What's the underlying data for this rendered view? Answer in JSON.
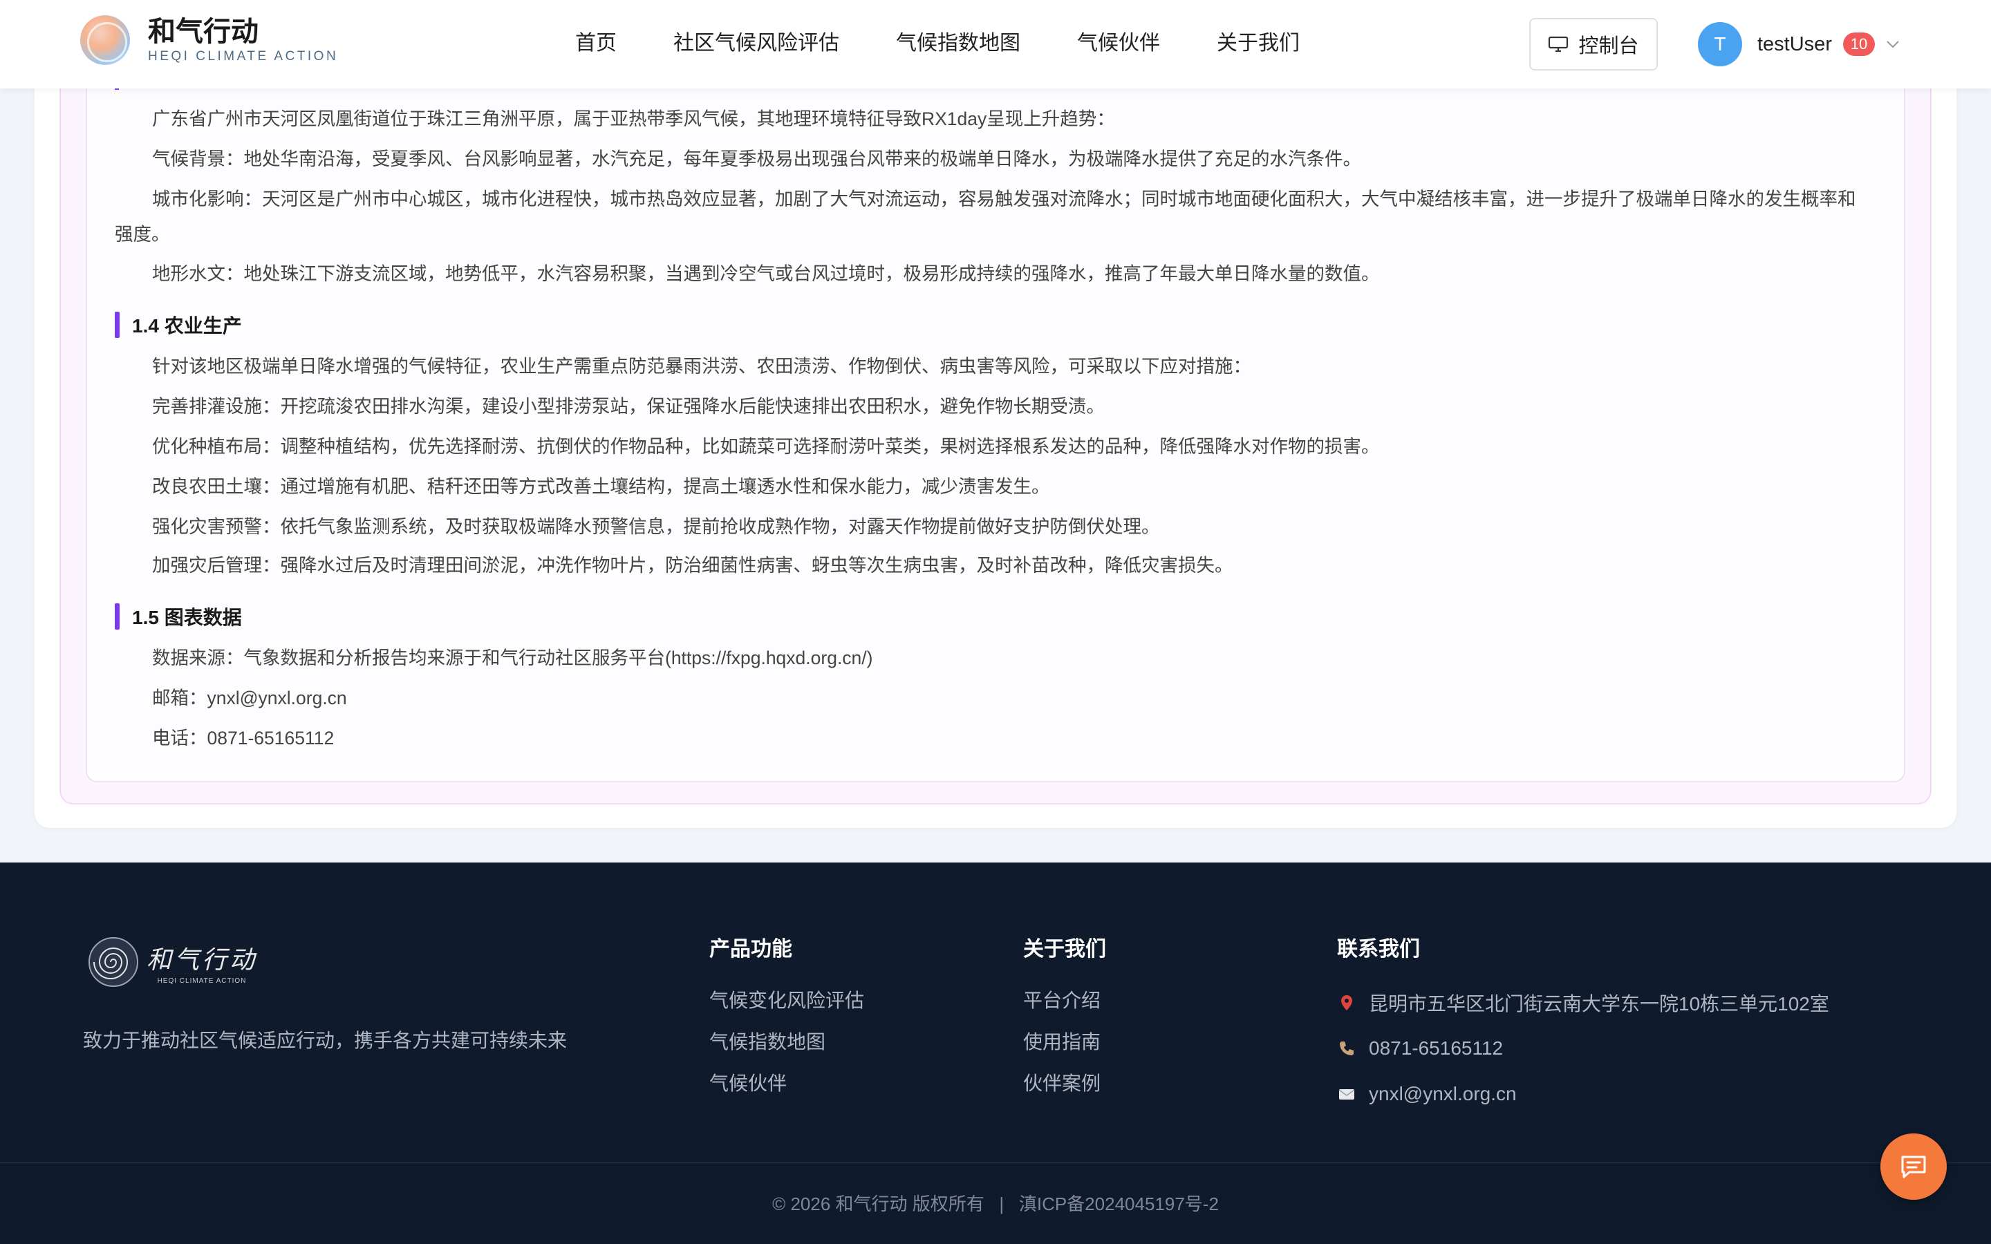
{
  "header": {
    "logo_title": "和气行动",
    "logo_subtitle": "HEQI CLIMATE ACTION",
    "nav": [
      {
        "label": "首页"
      },
      {
        "label": "社区气候风险评估"
      },
      {
        "label": "气候指数地图"
      },
      {
        "label": "气候伙伴"
      },
      {
        "label": "关于我们"
      }
    ],
    "console_label": "控制台",
    "user": {
      "avatar_initial": "T",
      "name": "testUser",
      "badge_count": "10"
    }
  },
  "content": {
    "intro": "广东省广州市天河区凤凰街道位于珠江三角洲平原，属于亚热带季风气候，其地理环境特征导致RX1day呈现上升趋势：",
    "climate_bg": "气候背景：地处华南沿海，受夏季风、台风影响显著，水汽充足，每年夏季极易出现强台风带来的极端单日降水，为极端降水提供了充足的水汽条件。",
    "urban": "城市化影响：天河区是广州市中心城区，城市化进程快，城市热岛效应显著，加剧了大气对流运动，容易触发强对流降水；同时城市地面硬化面积大，大气中凝结核丰富，进一步提升了极端单日降水的发生概率和强度。",
    "terrain": "地形水文：地处珠江下游支流区域，地势低平，水汽容易积聚，当遇到冷空气或台风过境时，极易形成持续的强降水，推高了年最大单日降水量的数值。",
    "section_agri": "1.4 农业生产",
    "agri_intro": "针对该地区极端单日降水增强的气候特征，农业生产需重点防范暴雨洪涝、农田渍涝、作物倒伏、病虫害等风险，可采取以下应对措施：",
    "agri_items": [
      "完善排灌设施：开挖疏浚农田排水沟渠，建设小型排涝泵站，保证强降水后能快速排出农田积水，避免作物长期受渍。",
      "优化种植布局：调整种植结构，优先选择耐涝、抗倒伏的作物品种，比如蔬菜可选择耐涝叶菜类，果树选择根系发达的品种，降低强降水对作物的损害。",
      "改良农田土壤：通过增施有机肥、秸秆还田等方式改善土壤结构，提高土壤透水性和保水能力，减少渍害发生。",
      "强化灾害预警：依托气象监测系统，及时获取极端降水预警信息，提前抢收成熟作物，对露天作物提前做好支护防倒伏处理。",
      "加强灾后管理：强降水过后及时清理田间淤泥，冲洗作物叶片，防治细菌性病害、蚜虫等次生病虫害，及时补苗改种，降低灾害损失。"
    ],
    "section_chart": "1.5 图表数据",
    "data_source": "数据来源：气象数据和分析报告均来源于和气行动社区服务平台(https://fxpg.hqxd.org.cn/)",
    "email": "邮箱：ynxl@ynxl.org.cn",
    "phone": "电话：0871-65165112"
  },
  "footer": {
    "logo_cn": "和气行动",
    "logo_en": "HEQI CLIMATE ACTION",
    "slogan": "致力于推动社区气候适应行动，携手各方共建可持续未来",
    "products": {
      "title": "产品功能",
      "links": [
        "气候变化风险评估",
        "气候指数地图",
        "气候伙伴"
      ]
    },
    "about": {
      "title": "关于我们",
      "links": [
        "平台介绍",
        "使用指南",
        "伙伴案例"
      ]
    },
    "contact": {
      "title": "联系我们",
      "address": "昆明市五华区北门街云南大学东一院10栋三单元102室",
      "phone": "0871-65165112",
      "email": "ynxl@ynxl.org.cn"
    },
    "copyright": "© 2026 和气行动 版权所有   |   滇ICP备2024045197号-2"
  },
  "colors": {
    "accent": "#7c3aed",
    "fab": "#f5793b",
    "footer_bg": "#0f1a2c",
    "avatar": "#4aa3f0",
    "badge": "#f25a5a"
  },
  "icons": [
    "monitor-icon",
    "chevron-down-icon",
    "location-pin-icon",
    "phone-icon",
    "mail-icon",
    "chat-icon"
  ]
}
